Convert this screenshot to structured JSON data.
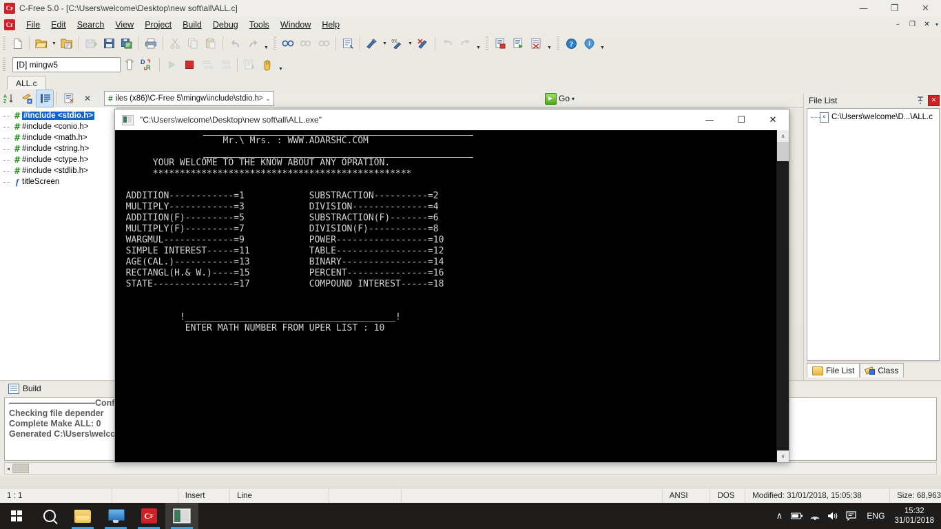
{
  "window": {
    "title": "C-Free 5.0 - [C:\\Users\\welcome\\Desktop\\new soft\\all\\ALL.c]",
    "app_icon": "c-free-icon",
    "minimize": "—",
    "maximize": "❐",
    "close": "✕"
  },
  "menubar": {
    "items": [
      {
        "label": "File"
      },
      {
        "label": "Edit"
      },
      {
        "label": "Search"
      },
      {
        "label": "View"
      },
      {
        "label": "Project"
      },
      {
        "label": "Build"
      },
      {
        "label": "Debug"
      },
      {
        "label": "Tools"
      },
      {
        "label": "Window"
      },
      {
        "label": "Help"
      }
    ],
    "mdi": {
      "minimize": "–",
      "restore": "❐",
      "close": "✕",
      "more": "▾"
    }
  },
  "toolbar_main": {
    "buttons": [
      {
        "name": "new-file",
        "glyph": "new"
      },
      {
        "name": "open-file",
        "glyph": "open",
        "caret": true
      },
      {
        "name": "open-project",
        "glyph": "openproj"
      },
      {
        "name": "save-all-disabled",
        "glyph": "saveall",
        "disabled": true
      },
      {
        "name": "save",
        "glyph": "save"
      },
      {
        "name": "save-copy",
        "glyph": "savecopy"
      },
      {
        "name": "print",
        "glyph": "print"
      },
      {
        "name": "cut",
        "glyph": "cut",
        "disabled": true
      },
      {
        "name": "copy",
        "glyph": "copy",
        "disabled": true
      },
      {
        "name": "paste",
        "glyph": "paste",
        "disabled": true
      },
      {
        "name": "undo",
        "glyph": "undo",
        "disabled": true
      },
      {
        "name": "redo",
        "glyph": "redo",
        "disabled": true
      }
    ],
    "buttons2": [
      {
        "name": "find",
        "glyph": "find"
      },
      {
        "name": "find-next",
        "glyph": "findnext",
        "disabled": true
      },
      {
        "name": "find-prev",
        "glyph": "findprev",
        "disabled": true
      },
      {
        "name": "replace",
        "glyph": "replace"
      },
      {
        "name": "build",
        "glyph": "build",
        "caret": true
      },
      {
        "name": "build-run",
        "glyph": "buildrun",
        "caret": true
      },
      {
        "name": "rebuild",
        "glyph": "rebuild"
      },
      {
        "name": "back",
        "glyph": "back",
        "disabled": true
      },
      {
        "name": "forward",
        "glyph": "forward",
        "disabled": true
      },
      {
        "name": "compile-file",
        "glyph": "compilefile"
      },
      {
        "name": "run-file",
        "glyph": "runfile"
      },
      {
        "name": "stop-build",
        "glyph": "stopbuild"
      },
      {
        "name": "help",
        "glyph": "help"
      },
      {
        "name": "about",
        "glyph": "about"
      }
    ]
  },
  "toolbar_build": {
    "compiler_value": "[D] mingw5",
    "buttons": [
      {
        "name": "configure-compiler",
        "glyph": "conf"
      },
      {
        "name": "debug-release-switch",
        "glyph": "dr"
      },
      {
        "name": "run",
        "glyph": "run",
        "disabled": true
      },
      {
        "name": "stop",
        "glyph": "stop"
      },
      {
        "name": "step-into",
        "glyph": "stepinto",
        "disabled": true
      },
      {
        "name": "step-over",
        "glyph": "stepover",
        "disabled": true
      },
      {
        "name": "watch",
        "glyph": "watch",
        "disabled": true
      },
      {
        "name": "pause-hand",
        "glyph": "hand"
      }
    ]
  },
  "doc_tabs": [
    {
      "label": "ALL.c",
      "active": true
    }
  ],
  "navbar": {
    "buttons": [
      {
        "name": "sort-alpha",
        "glyph": "az"
      },
      {
        "name": "class-view",
        "glyph": "class"
      },
      {
        "name": "symbol-list",
        "glyph": "symbols",
        "active": true
      },
      {
        "name": "properties",
        "glyph": "props"
      }
    ],
    "close_glyph": "✕",
    "include_value": "iles (x86)\\C-Free 5\\mingw\\include\\stdio.h>",
    "include_hash": "#",
    "chevron": "⌄",
    "go_label": "Go",
    "go_caret": "▾"
  },
  "tree": {
    "items": [
      {
        "label": "#include <stdio.h>",
        "icon": "hash-icon",
        "selected": true
      },
      {
        "label": "#include <conio.h>",
        "icon": "hash-icon",
        "selected": false
      },
      {
        "label": "#include <math.h>",
        "icon": "hash-icon",
        "selected": false
      },
      {
        "label": "#include <string.h>",
        "icon": "hash-icon",
        "selected": false
      },
      {
        "label": "#include <ctype.h>",
        "icon": "hash-icon",
        "selected": false
      },
      {
        "label": "#include <stdlib.h>",
        "icon": "hash-icon",
        "selected": false
      },
      {
        "label": "titleScreen",
        "icon": "function-icon",
        "selected": false
      }
    ]
  },
  "build_panel": {
    "tab_label": "Build",
    "lines": [
      "——————————Configur",
      "",
      "Checking file depender",
      "",
      "Complete Make ALL: 0",
      "Generated C:\\Users\\welcome\\Desktop\\new soft\\all\\ALL.exe"
    ],
    "scroll_left": "◂"
  },
  "right_dock": {
    "title": "File List",
    "pin_glyph": "⟳",
    "close_glyph": "✕",
    "items": [
      {
        "label": "C:\\Users\\welcome\\D...\\ALL.c",
        "icon": "c-file-icon"
      }
    ],
    "tabs": [
      {
        "label": "File List",
        "icon": "folder-icon",
        "active": true
      },
      {
        "label": "Class",
        "icon": "class-icon",
        "active": false
      }
    ],
    "bottom_strip": {
      "pin_glyph": "⟳",
      "close_glyph": "✕"
    }
  },
  "statusbar": {
    "cursor": "1 : 1",
    "blank1": "",
    "mode": "Insert",
    "line_mode": "Line",
    "blank2": "",
    "blank3": "",
    "encoding": "ANSI",
    "line_ending": "DOS",
    "modified": "Modified: 31/01/2018, 15:05:38",
    "size": "Size: 68,963"
  },
  "console": {
    "title": "\"C:\\Users\\welcome\\Desktop\\new soft\\all\\ALL.exe\"",
    "icon": "console-icon",
    "minimize": "—",
    "maximize": "☐",
    "close": "✕",
    "scroll_up": "∧",
    "scroll_down": "∨",
    "lines": [
      "                    Mr.\\ Mrs. : WWW.ADARSHC.COM",
      "",
      "       YOUR WELCOME TO THE KNOW ABOUT ANY OPRATION.",
      "       ************************************************",
      "",
      "  ADDITION------------=1            SUBSTRACTION----------=2",
      "  MULTIPLY------------=3            DIVISION--------------=4",
      "  ADDITION(F)---------=5            SUBSTRACTION(F)-------=6",
      "  MULTIPLY(F)---------=7            DIVISION(F)-----------=8",
      "  WARGMUL-------------=9            POWER-----------------=10",
      "  SIMPLE INTEREST-----=11           TABLE-----------------=12",
      "  AGE(CAL.)-----------=13           BINARY----------------=14",
      "  RECTANGL(H.& W.)----=15           PERCENT---------------=16",
      "  STATE---------------=17           COMPOUND INTEREST-----=18",
      "",
      "",
      "            !_______________________________________!",
      "             ENTER MATH NUMBER FROM UPER LIST : 10"
    ]
  },
  "taskbar": {
    "start": "windows-logo",
    "items": [
      {
        "name": "start-button",
        "icon": "windows-logo-icon"
      },
      {
        "name": "search-button",
        "icon": "search-icon"
      },
      {
        "name": "file-explorer",
        "icon": "folder-icon",
        "running": true
      },
      {
        "name": "visual-studio",
        "icon": "monitor-icon",
        "running": true
      },
      {
        "name": "c-free",
        "icon": "c-free-icon",
        "running": true
      },
      {
        "name": "console-app",
        "icon": "console-icon",
        "running": true,
        "active": true
      }
    ],
    "tray": {
      "chevron": "∧",
      "battery": "battery-icon",
      "wifi": "wifi-icon",
      "volume": "volume-icon",
      "notifications": "notification-icon",
      "language": "ENG",
      "time": "15:32",
      "date": "31/01/2018"
    }
  }
}
